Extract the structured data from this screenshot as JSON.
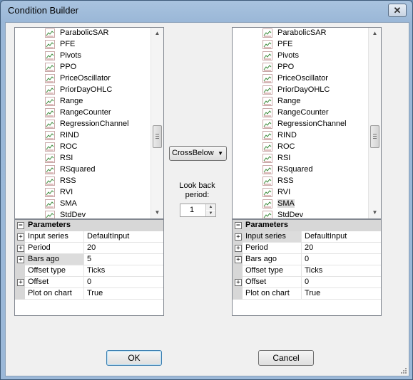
{
  "window": {
    "title": "Condition Builder",
    "close_label": "✕"
  },
  "left": {
    "items": [
      "ParabolicSAR",
      "PFE",
      "Pivots",
      "PPO",
      "PriceOscillator",
      "PriorDayOHLC",
      "Range",
      "RangeCounter",
      "RegressionChannel",
      "RIND",
      "ROC",
      "RSI",
      "RSquared",
      "RSS",
      "RVI",
      "SMA",
      "StdDev"
    ],
    "selected_item": "",
    "params": {
      "header": "Parameters",
      "rows": [
        {
          "name": "Input series",
          "value": "DefaultInput",
          "expandable": true,
          "selected": false
        },
        {
          "name": "Period",
          "value": "20",
          "expandable": true,
          "selected": false
        },
        {
          "name": "Bars ago",
          "value": "5",
          "expandable": true,
          "selected": true
        },
        {
          "name": "Offset type",
          "value": "Ticks",
          "expandable": false,
          "selected": false
        },
        {
          "name": "Offset",
          "value": "0",
          "expandable": true,
          "selected": false
        },
        {
          "name": "Plot on chart",
          "value": "True",
          "expandable": false,
          "selected": false
        }
      ]
    }
  },
  "right": {
    "items": [
      "ParabolicSAR",
      "PFE",
      "Pivots",
      "PPO",
      "PriceOscillator",
      "PriorDayOHLC",
      "Range",
      "RangeCounter",
      "RegressionChannel",
      "RIND",
      "ROC",
      "RSI",
      "RSquared",
      "RSS",
      "RVI",
      "SMA",
      "StdDev"
    ],
    "selected_item": "SMA",
    "params": {
      "header": "Parameters",
      "rows": [
        {
          "name": "Input series",
          "value": "DefaultInput",
          "expandable": true,
          "selected": true
        },
        {
          "name": "Period",
          "value": "20",
          "expandable": true,
          "selected": false
        },
        {
          "name": "Bars ago",
          "value": "0",
          "expandable": true,
          "selected": false
        },
        {
          "name": "Offset type",
          "value": "Ticks",
          "expandable": false,
          "selected": false
        },
        {
          "name": "Offset",
          "value": "0",
          "expandable": true,
          "selected": false
        },
        {
          "name": "Plot on chart",
          "value": "True",
          "expandable": false,
          "selected": false
        }
      ]
    }
  },
  "condition": {
    "operator": "CrossBelow"
  },
  "lookback": {
    "label_line1": "Look back",
    "label_line2": "period:",
    "value": "1"
  },
  "buttons": {
    "ok": "OK",
    "cancel": "Cancel"
  }
}
